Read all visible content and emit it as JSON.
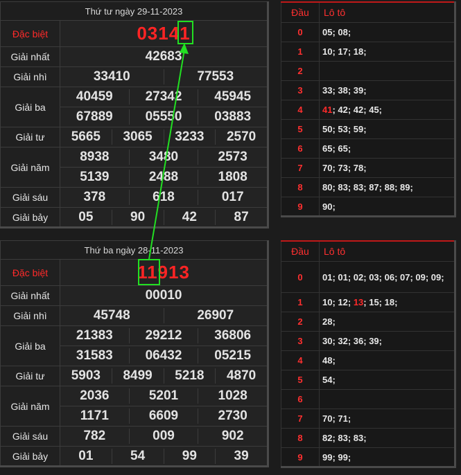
{
  "results": [
    {
      "date_title": "Thứ tư ngày 29-11-2023",
      "labels": {
        "db": "Đặc biệt",
        "g1": "Giải nhất",
        "g2": "Giải nhì",
        "g3": "Giải ba",
        "g4": "Giải tư",
        "g5": "Giải năm",
        "g6": "Giải sáu",
        "g7": "Giải bảy"
      },
      "db": "03141",
      "g1": "42683",
      "g2": [
        "33410",
        "77553"
      ],
      "g3": [
        "40459",
        "27342",
        "45945",
        "67889",
        "05550",
        "03883"
      ],
      "g4": [
        "5665",
        "3065",
        "3233",
        "2570"
      ],
      "g5": [
        "8938",
        "3480",
        "2573",
        "5139",
        "2488",
        "1808"
      ],
      "g6": [
        "378",
        "618",
        "017"
      ],
      "g7": [
        "05",
        "90",
        "42",
        "87"
      ],
      "loto_header": {
        "dau": "Đầu",
        "loto": "Lô tô"
      },
      "loto": [
        {
          "dau": "0",
          "val": "05; 08;"
        },
        {
          "dau": "1",
          "val": "10; 17; 18;"
        },
        {
          "dau": "2",
          "val": ""
        },
        {
          "dau": "3",
          "val": "33; 38; 39;"
        },
        {
          "dau": "4",
          "hl": "41",
          "val": "; 42; 42; 45;"
        },
        {
          "dau": "5",
          "val": "50; 53; 59;"
        },
        {
          "dau": "6",
          "val": "65; 65;"
        },
        {
          "dau": "7",
          "val": "70; 73; 78;"
        },
        {
          "dau": "8",
          "val": "80; 83; 83; 87; 88; 89;"
        },
        {
          "dau": "9",
          "val": "90;"
        }
      ]
    },
    {
      "date_title": "Thứ ba ngày 28-11-2023",
      "labels": {
        "db": "Đặc biệt",
        "g1": "Giải nhất",
        "g2": "Giải nhì",
        "g3": "Giải ba",
        "g4": "Giải tư",
        "g5": "Giải năm",
        "g6": "Giải sáu",
        "g7": "Giải bảy"
      },
      "db": "11913",
      "g1": "00010",
      "g2": [
        "45748",
        "26907"
      ],
      "g3": [
        "21383",
        "29212",
        "36806",
        "31583",
        "06432",
        "05215"
      ],
      "g4": [
        "5903",
        "8499",
        "5218",
        "4870"
      ],
      "g5": [
        "2036",
        "5201",
        "1028",
        "1171",
        "6609",
        "2730"
      ],
      "g6": [
        "782",
        "009",
        "902"
      ],
      "g7": [
        "01",
        "54",
        "99",
        "39"
      ],
      "loto_header": {
        "dau": "Đầu",
        "loto": "Lô tô"
      },
      "loto": [
        {
          "dau": "0",
          "val": "01; 01; 02; 03; 06; 07; 09; 09;"
        },
        {
          "dau": "1",
          "pre": "10; 12; ",
          "hl": "13",
          "val": "; 15; 18;"
        },
        {
          "dau": "2",
          "val": "28;"
        },
        {
          "dau": "3",
          "val": "30; 32; 36; 39;"
        },
        {
          "dau": "4",
          "val": "48;"
        },
        {
          "dau": "5",
          "val": "54;"
        },
        {
          "dau": "6",
          "val": ""
        },
        {
          "dau": "7",
          "val": "70; 71;"
        },
        {
          "dau": "8",
          "val": "82; 83; 83;"
        },
        {
          "dau": "9",
          "val": "99; 99;"
        }
      ]
    }
  ]
}
